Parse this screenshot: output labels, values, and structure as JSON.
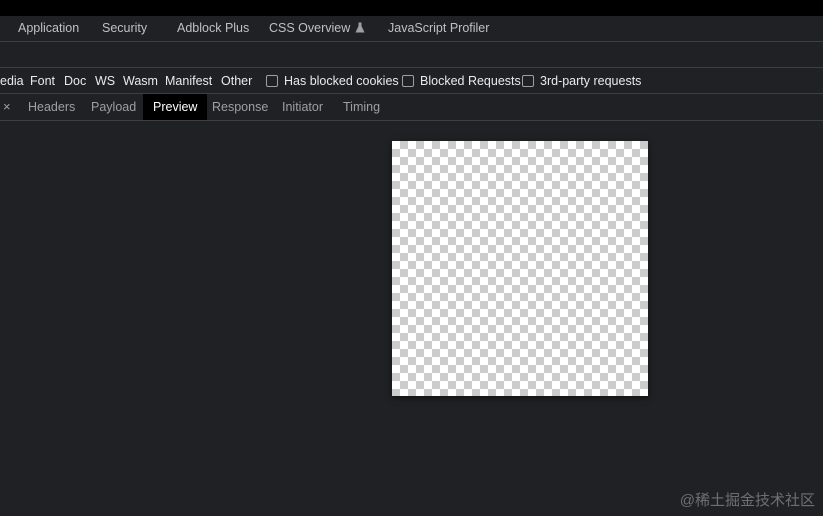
{
  "panel_tabs": [
    "Application",
    "Security",
    "Adblock Plus",
    "CSS Overview",
    "JavaScript Profiler"
  ],
  "panel_tab_icons": {
    "css_overview": "flask-icon"
  },
  "filters": {
    "types": [
      "edia",
      "Font",
      "Doc",
      "WS",
      "Wasm",
      "Manifest",
      "Other"
    ],
    "checkboxes": [
      {
        "label": "Has blocked cookies",
        "checked": false
      },
      {
        "label": "Blocked Requests",
        "checked": false
      },
      {
        "label": "3rd-party requests",
        "checked": false
      }
    ]
  },
  "detail_tabs": [
    "Headers",
    "Payload",
    "Preview",
    "Response",
    "Initiator",
    "Timing"
  ],
  "detail_active_tab": "Preview",
  "icons": {
    "close": "close-icon",
    "close_glyph": "×"
  },
  "colors": {
    "background": "#202124",
    "active_tab_bg": "#000000",
    "checker_dark": "#cccccc"
  },
  "watermark": "@稀土掘金技术社区"
}
